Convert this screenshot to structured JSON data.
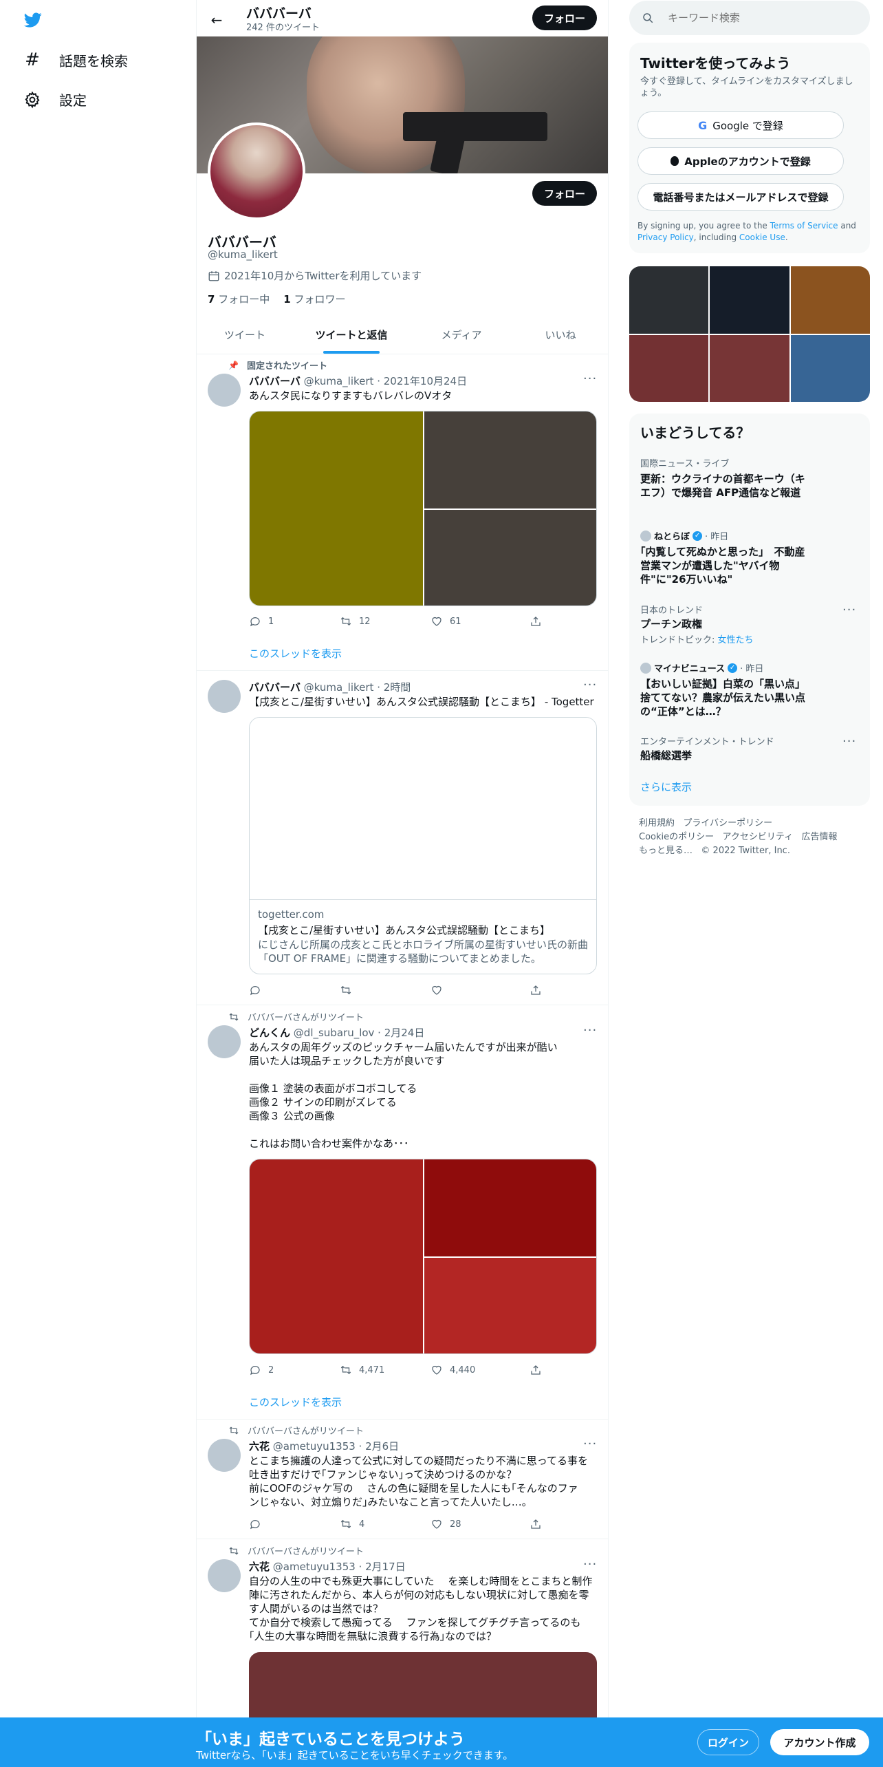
{
  "nav": {
    "explore_label": "話題を検索",
    "settings_label": "設定"
  },
  "header": {
    "name": "バババーバ",
    "tweet_count": "242 件のツイート",
    "follow_label": "フォロー"
  },
  "profile": {
    "name": "バババーバ",
    "handle": "@kuma_likert",
    "joined": "2021年10月からTwitterを利用しています",
    "following_count": "7",
    "following_label": "フォロー中",
    "followers_count": "1",
    "followers_label": "フォロワー",
    "follow_label": "フォロー"
  },
  "tabs": [
    "ツイート",
    "ツイートと返信",
    "メディア",
    "いいね"
  ],
  "tweets": {
    "t1": {
      "pinned": "固定されたツイート",
      "name": "バババーバ",
      "handle_time": "@kuma_likert · 2021年10月24日",
      "text": "あんスタ民になりすますもバレバレのVオタ",
      "img_colors": [
        "#7f7700",
        "#46403a",
        "#46403a"
      ],
      "replies": "1",
      "retweets": "12",
      "likes": "61",
      "thread": "このスレッドを表示"
    },
    "t2": {
      "name": "バババーバ",
      "handle_time": "@kuma_likert · 2時間",
      "text": "【戌亥とこ/星街すいせい】あんスタ公式誤認騒動【とこまち】 - Togetter",
      "card_domain": "togetter.com",
      "card_title": "【戌亥とこ/星街すいせい】あんスタ公式誤認騒動【とこまち】",
      "card_desc": "にじさんじ所属の戌亥とこ氏とホロライブ所属の星街すいせい氏の新曲「OUT OF FRAME」に関連する騒動についてまとめました。"
    },
    "t3": {
      "rt_label": "バババーバさんがリツイート",
      "name": "どんくん",
      "handle_time": "@dl_subaru_lov · 2月24日",
      "text": "あんスタの周年グッズのピックチャーム届いたんですが出来が酷い\n届いた人は現品チェックした方が良いです\n\n画像１ 塗装の表面がボコボコしてる\n画像２ サインの印刷がズレてる\n画像３ 公式の画像\n\nこれはお問い合わせ案件かなあ･･･",
      "img_colors": [
        "#a81f1c",
        "#8f0c0c",
        "#b32624"
      ],
      "replies": "2",
      "retweets": "4,471",
      "likes": "4,440",
      "thread": "このスレッドを表示"
    },
    "t4": {
      "rt_label": "バババーバさんがリツイート",
      "name": "六花",
      "handle_time": "@ametuyu1353 · 2月6日",
      "text": "とこまち擁護の人達って公式に対しての疑問だったり不満に思ってる事を\n吐き出すだけで｢ファンじゃない｣って決めつけるのかな？\n前にOOFのジャケ写の　 さんの色に疑問を呈した人にも｢そんなのファ\nンじゃない、対立煽りだ｣みたいなこと言ってた人いたし…。",
      "replies": "",
      "retweets": "4",
      "likes": "28"
    },
    "t5": {
      "rt_label": "バババーバさんがリツイート",
      "name": "六花",
      "handle_time": "@ametuyu1353 · 2月17日",
      "text": "自分の人生の中でも殊更大事にしていた　 を楽しむ時間をとこまちと制作\n陣に汚されたんだから、本人らが何の対応もしない現状に対して愚痴を零\nす人間がいるのは当然では？\nてか自分で検索して愚痴ってる　 ファンを探してグチグチ言ってるのも\n｢人生の大事な時間を無駄に浪費する行為｣なのでは？",
      "img_color": "#6e3234"
    }
  },
  "search": {
    "placeholder": "キーワード検索"
  },
  "signup": {
    "title": "Twitterを使ってみよう",
    "subtitle": "今すぐ登録して、タイムラインをカスタマイズしましょう。",
    "google": "Google で登録",
    "apple": "Appleのアカウントで登録",
    "phone": "電話番号またはメールアドレスで登録",
    "terms_pre": "By signing up, you agree to the ",
    "terms_link": "Terms of Service",
    "terms_mid": " and ",
    "privacy_link": "Privacy Policy",
    "terms_mid2": ", including ",
    "cookie_link": "Cookie Use",
    "terms_end": "."
  },
  "media_grid_colors": [
    "#2b2f33",
    "#151d29",
    "#8b531f",
    "#733133",
    "#773536",
    "#376595"
  ],
  "trends": {
    "title": "いまどうしてる？",
    "items": [
      {
        "ctx": "国際ニュース・ライブ",
        "text": "更新：ウクライナの首都キーウ（キエフ）で爆発音 AFP通信など報道"
      },
      {
        "ctx": "ねとらぼ",
        "time": "· 昨日",
        "text": "｢内覧して死ぬかと思った｣　不動産営業マンが遭遇した\"ヤバイ物件\"に\"26万いいね\""
      },
      {
        "ctx": "日本のトレンド",
        "text": "プーチン政権",
        "sub_pre": "トレンドトピック: ",
        "sub_link": "女性たち"
      },
      {
        "ctx": "マイナビニュース",
        "time": "· 昨日",
        "text": "【おいしい証拠】白菜の「黒い点」捨ててない？農家が伝えたい黒い点の“正体”とは…？"
      },
      {
        "ctx": "エンターテインメント・トレンド",
        "text": "船橋総選挙"
      }
    ],
    "more": "さらに表示"
  },
  "footer": {
    "links": [
      "利用規約",
      "プライバシーポリシー",
      "Cookieのポリシー",
      "アクセシビリティ",
      "広告情報",
      "もっと見る…",
      "© 2022 Twitter, Inc."
    ]
  },
  "bottom_bar": {
    "title": "「いま」起きていることを見つけよう",
    "subtitle": "Twitterなら、「いま」起きていることをいち早くチェックできます。",
    "login": "ログイン",
    "signup": "アカウント作成"
  }
}
